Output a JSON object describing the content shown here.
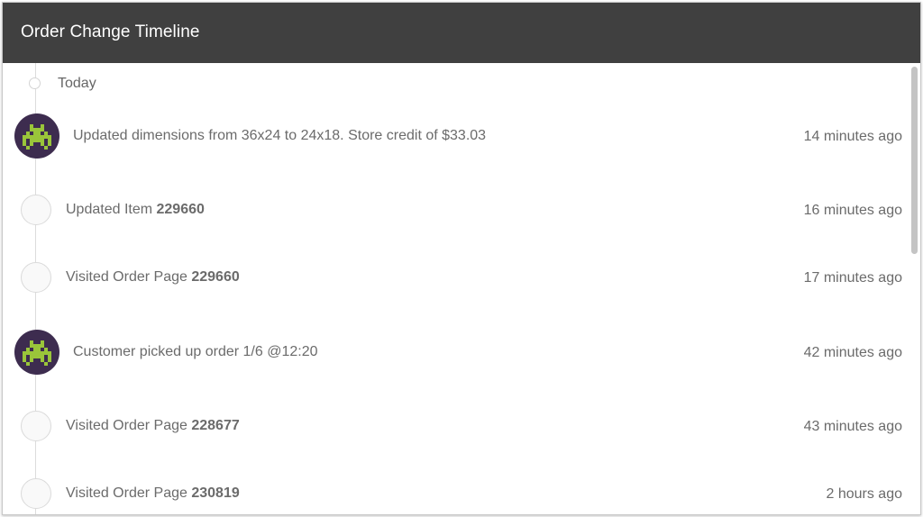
{
  "header": {
    "title": "Order Change Timeline"
  },
  "timeline": {
    "group_label": "Today",
    "entries": [
      {
        "type": "note",
        "icon": "space-invader-avatar",
        "text": "Updated dimensions from 36x24 to 24x18. Store credit of $33.03",
        "time": "14 minutes ago"
      },
      {
        "type": "event",
        "text_prefix": "Updated Item ",
        "text_bold": "229660",
        "time": "16 minutes ago"
      },
      {
        "type": "event",
        "text_prefix": "Visited Order Page ",
        "text_bold": "229660",
        "time": "17 minutes ago"
      },
      {
        "type": "note",
        "icon": "space-invader-avatar",
        "text": "Customer picked up order 1/6 @12:20",
        "time": "42 minutes ago"
      },
      {
        "type": "event",
        "text_prefix": "Visited Order Page ",
        "text_bold": "228677",
        "time": "43 minutes ago"
      },
      {
        "type": "event",
        "text_prefix": "Visited Order Page ",
        "text_bold": "230819",
        "time": "2 hours ago"
      }
    ]
  },
  "colors": {
    "header_bg": "#404040",
    "avatar_bg": "#3d2c4f",
    "avatar_fg": "#9ac53a",
    "text": "#6b6b6b"
  }
}
